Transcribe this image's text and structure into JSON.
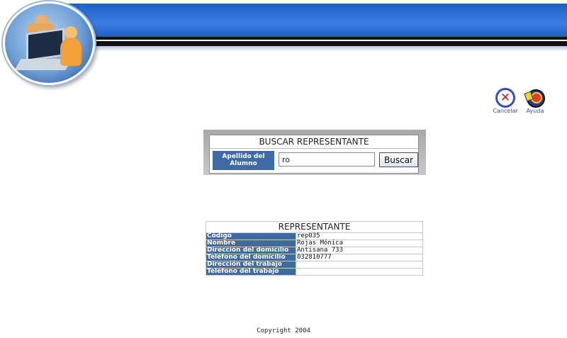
{
  "actions": {
    "cancel_label": "Cancelar",
    "help_label": "Ayuda"
  },
  "search": {
    "title": "BUSCAR REPRESENTANTE",
    "field_label": "Apellido del Alumno",
    "value": "ro",
    "button_label": "Buscar"
  },
  "result": {
    "title": "REPRESENTANTE",
    "rows": [
      {
        "label": "Código",
        "value": "rep035"
      },
      {
        "label": "Nombre",
        "value": "Rojas Mónica"
      },
      {
        "label": "Dirección del domicilio",
        "value": "Antisana 733"
      },
      {
        "label": "Teléfono del domicilio",
        "value": "032810777"
      },
      {
        "label": "Dirección del trabajo",
        "value": ""
      },
      {
        "label": "Teléfono del trabajo",
        "value": ""
      }
    ]
  },
  "footer": "Copyright 2004",
  "colors": {
    "banner_blue": "#2f72d8",
    "label_blue": "#3e6aa6",
    "cancel_red": "#cc1a1a"
  }
}
